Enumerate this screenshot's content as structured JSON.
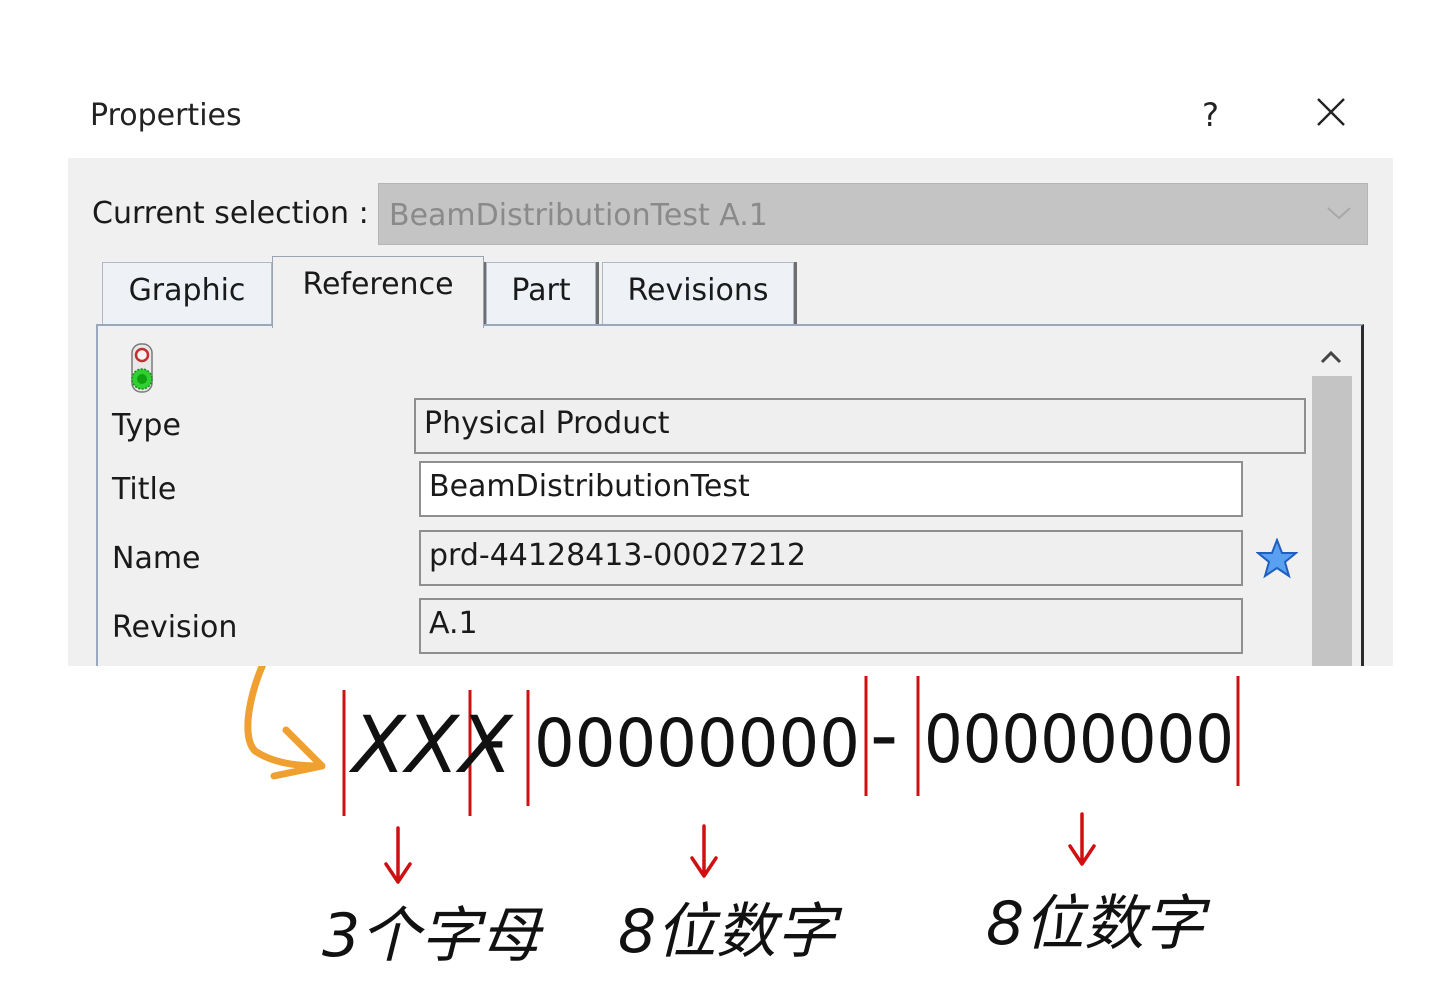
{
  "dialog": {
    "title": "Properties",
    "help_label": "?",
    "close_label": "✕"
  },
  "selection": {
    "label": "Current selection :",
    "value": "BeamDistributionTest A.1"
  },
  "tabs": [
    {
      "label": "Graphic",
      "active": false
    },
    {
      "label": "Reference",
      "active": true
    },
    {
      "label": "Part",
      "active": false
    },
    {
      "label": "Revisions",
      "active": false
    }
  ],
  "fields": {
    "type": {
      "label": "Type",
      "value": "Physical Product"
    },
    "title": {
      "label": "Title",
      "value": "BeamDistributionTest"
    },
    "name": {
      "label": "Name",
      "value": "prd-44128413-00027212"
    },
    "revision": {
      "label": "Revision",
      "value": "A.1"
    }
  },
  "annotation": {
    "pattern_prefix": "XXX",
    "dash1": "-",
    "pattern_group1": "00000000",
    "dash2": "-",
    "pattern_group2": "00000000",
    "note_prefix": "3个字母",
    "note_group1": "8位数字",
    "note_group2": "8位数字",
    "colors": {
      "arrow": "#f0a030",
      "markers": "#d01010",
      "ink": "#111111"
    }
  }
}
